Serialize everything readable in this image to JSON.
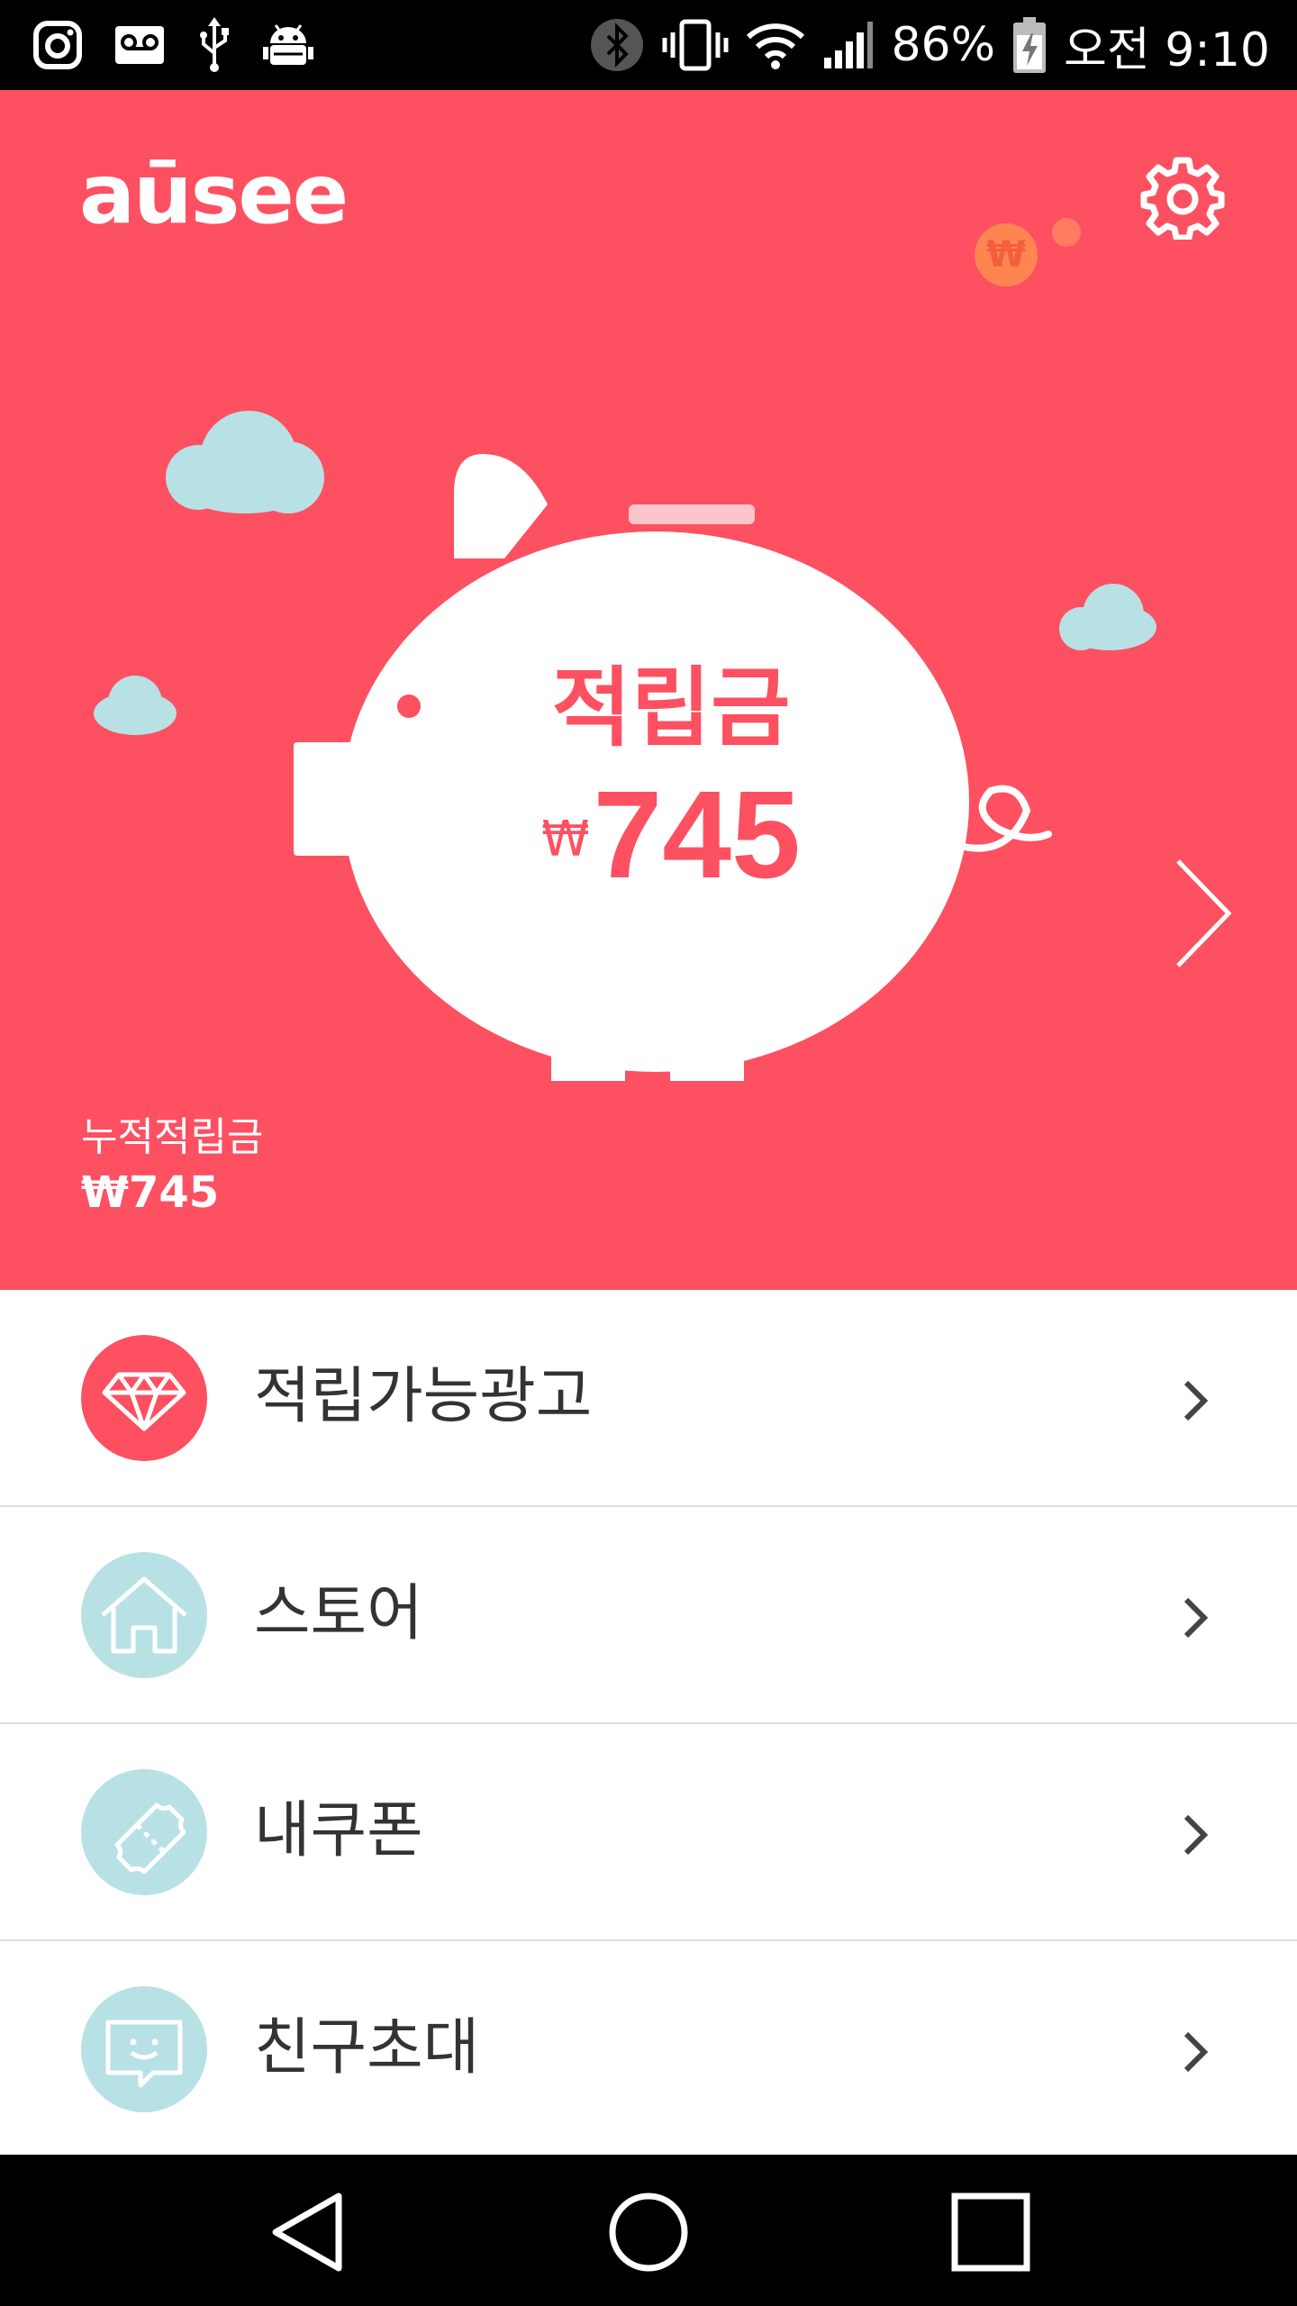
{
  "status_bar": {
    "battery_percent": "86%",
    "time": "오전 9:10",
    "left_icons": [
      "instagram-icon",
      "voicemail-icon",
      "usb-icon",
      "android-debug-icon"
    ],
    "right_icons": [
      "bluetooth-icon",
      "vibrate-icon",
      "wifi-icon",
      "signal-icon",
      "battery-charging-icon"
    ]
  },
  "header": {
    "logo": "aūsee",
    "settings_icon": "gear-icon"
  },
  "hero": {
    "background_color": "#fd5061",
    "balance_label": "적립금",
    "currency_symbol": "₩",
    "balance_amount": "745",
    "accumulated_label": "누적적립금",
    "accumulated_amount": "₩745",
    "next_icon": "chevron-right-icon"
  },
  "menu": {
    "items": [
      {
        "label": "적립가능광고",
        "icon": "diamond-icon",
        "icon_color": "#fd5061"
      },
      {
        "label": "스토어",
        "icon": "house-icon",
        "icon_color": "#b8e1e5"
      },
      {
        "label": "내쿠폰",
        "icon": "ticket-icon",
        "icon_color": "#b8e1e5"
      },
      {
        "label": "친구초대",
        "icon": "chat-bubble-icon",
        "icon_color": "#b8e1e5"
      }
    ]
  },
  "nav_bar": {
    "back_icon": "back-triangle-icon",
    "home_icon": "home-circle-icon",
    "recents_icon": "recents-square-icon"
  }
}
